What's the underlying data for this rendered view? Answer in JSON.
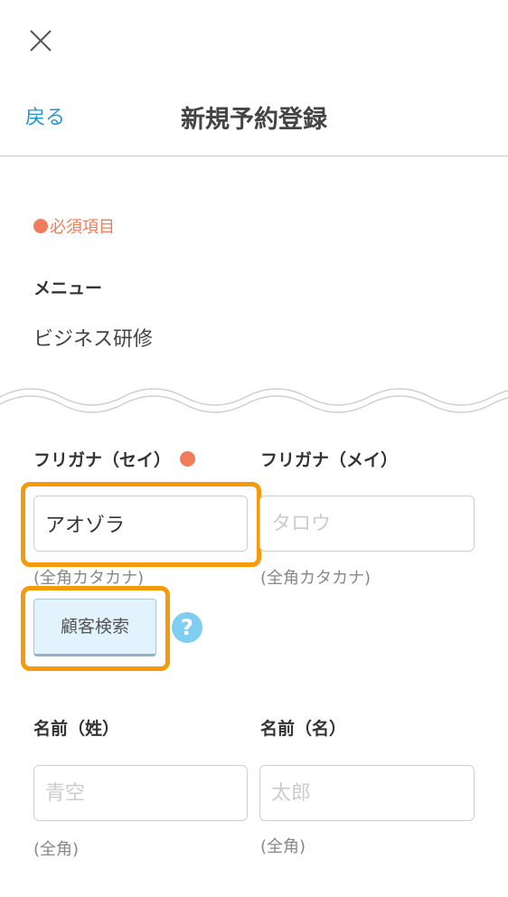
{
  "header": {
    "close_icon": "close-icon",
    "back_label": "戻る",
    "title": "新規予約登録"
  },
  "required_note": "必須項目",
  "menu": {
    "label": "メニュー",
    "value": "ビジネス研修"
  },
  "furigana_sei": {
    "label": "フリガナ（セイ）",
    "value": "アオゾラ",
    "hint": "(全角カタカナ)",
    "required": true
  },
  "furigana_mei": {
    "label": "フリガナ（メイ）",
    "placeholder": "タロウ",
    "hint": "(全角カタカナ)"
  },
  "customer_search": {
    "label": "顧客検索",
    "help_glyph": "?"
  },
  "last_name": {
    "label": "名前（姓）",
    "placeholder": "青空",
    "hint": "(全角)"
  },
  "first_name": {
    "label": "名前（名）",
    "placeholder": "太郎",
    "hint": "(全角)"
  },
  "colors": {
    "accent_link": "#2a95c8",
    "required": "#f07c5b",
    "highlight": "#f59a0c",
    "button_bg": "#e3f3fd",
    "help_icon": "#7fcdf0"
  }
}
